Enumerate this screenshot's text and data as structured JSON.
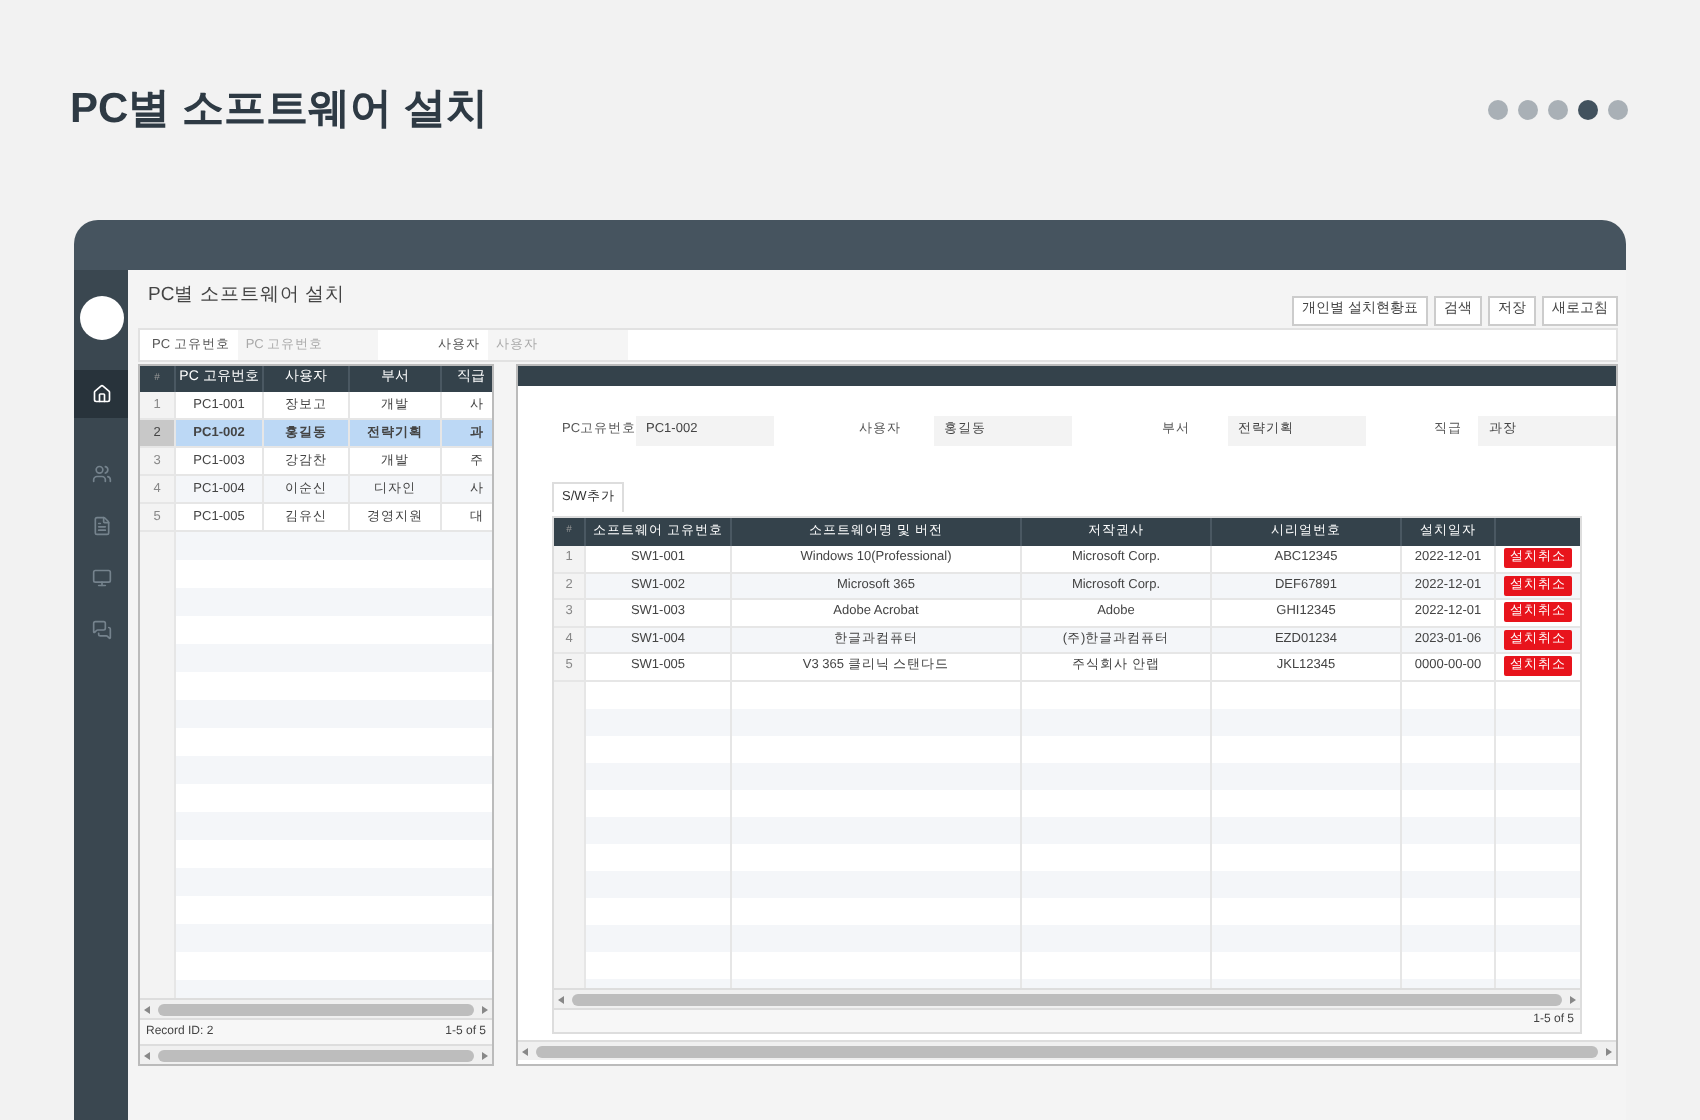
{
  "page_title": "PC별 소프트웨어 설치",
  "page_dots": [
    {
      "selected": false
    },
    {
      "selected": false
    },
    {
      "selected": false
    },
    {
      "selected": true
    },
    {
      "selected": false
    }
  ],
  "sidebar": {
    "items": [
      {
        "kind": "home",
        "selected": true
      },
      {
        "kind": "users",
        "selected": false
      },
      {
        "kind": "file",
        "selected": false
      },
      {
        "kind": "monitor",
        "selected": false
      },
      {
        "kind": "chat",
        "selected": false
      }
    ]
  },
  "screen_title": "PC별 소프트웨어 설치",
  "buttons": [
    "개인별 설치현황표",
    "검색",
    "저장",
    "새로고침"
  ],
  "search": [
    {
      "label": "PC 고유번호",
      "placeholder": "PC 고유번호"
    },
    {
      "label": "사용자",
      "placeholder": "사용자"
    }
  ],
  "pc_grid": {
    "columns": [
      "#",
      "PC 고유번호",
      "사용자",
      "부서",
      "직급"
    ],
    "rows": [
      {
        "cells": [
          "1",
          "PC1-001",
          "장보고",
          "개발",
          "사"
        ],
        "selected": false
      },
      {
        "cells": [
          "2",
          "PC1-002",
          "홍길동",
          "전략기획",
          "과"
        ],
        "selected": true
      },
      {
        "cells": [
          "3",
          "PC1-003",
          "강감찬",
          "개발",
          "주"
        ],
        "selected": false
      },
      {
        "cells": [
          "4",
          "PC1-004",
          "이순신",
          "디자인",
          "사"
        ],
        "selected": false
      },
      {
        "cells": [
          "5",
          "PC1-005",
          "김유신",
          "경영지원",
          "대"
        ],
        "selected": false
      }
    ],
    "record": "Record ID: 2",
    "paging": "1-5 of 5"
  },
  "detail": {
    "fields": [
      {
        "label": "PC고유번호",
        "value": "PC1-002"
      },
      {
        "label": "사용자",
        "value": "홍길동"
      },
      {
        "label": "부서",
        "value": "전략기획"
      },
      {
        "label": "직급",
        "value": "과장"
      }
    ],
    "tab": "S/W추가",
    "columns": [
      "#",
      "소프트웨어 고유번호",
      "소프트웨어명 및 버전",
      "저작권사",
      "시리얼번호",
      "설치일자"
    ],
    "rows": [
      {
        "cells": [
          "1",
          "SW1-001",
          "Windows 10(Professional)",
          "Microsoft Corp.",
          "ABC12345",
          "2022-12-01"
        ],
        "action": "설치취소"
      },
      {
        "cells": [
          "2",
          "SW1-002",
          "Microsoft 365",
          "Microsoft Corp.",
          "DEF67891",
          "2022-12-01"
        ],
        "action": "설치취소"
      },
      {
        "cells": [
          "3",
          "SW1-003",
          "Adobe Acrobat",
          "Adobe",
          "GHI12345",
          "2022-12-01"
        ],
        "action": "설치취소"
      },
      {
        "cells": [
          "4",
          "SW1-004",
          "한글과컴퓨터",
          "(주)한글과컴퓨터",
          "EZD01234",
          "2023-01-06"
        ],
        "action": "설치취소"
      },
      {
        "cells": [
          "5",
          "SW1-005",
          "V3 365 클리닉 스탠다드",
          "주식회사 안랩",
          "JKL12345",
          "0000-00-00"
        ],
        "action": "설치취소"
      }
    ],
    "paging": "1-5 of 5"
  }
}
